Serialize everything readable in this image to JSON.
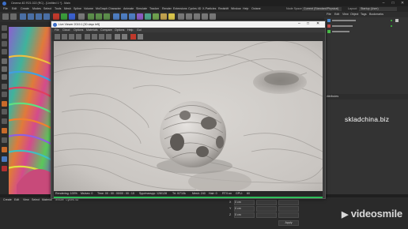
{
  "app": {
    "title": "Cinema 4D R21.022 (RC) - [Untitled 1 *] - Main",
    "win_controls": [
      "–",
      "□",
      "✕"
    ]
  },
  "main_menu": [
    "File",
    "Edit",
    "Create",
    "Modes",
    "Select",
    "Tools",
    "Mesh",
    "Spline",
    "Volume",
    "MoGraph",
    "Character",
    "Animate",
    "Simulate",
    "Tracker",
    "Render",
    "Extensions",
    "Cycles 4D",
    "X-Particles",
    "Redshift",
    "Window",
    "Help",
    "Octane"
  ],
  "node_space": {
    "label": "Node Space:",
    "value": "Current (Standard/Physical)",
    "layout_label": "Layout:",
    "layout_value": "Startup (User)"
  },
  "right_panel": {
    "tabs": [
      "File",
      "Edit",
      "View",
      "Object",
      "Tags",
      "Bookmarks"
    ],
    "attributes_label": "Attributes"
  },
  "live_viewer": {
    "title": "Live Viewer 2019.1 [30 days left]",
    "menu": [
      "File",
      "Cloud",
      "Options",
      "Materials",
      "Compare",
      "Options",
      "Help",
      "Gui"
    ],
    "status": {
      "rendering": "Rendering: 100%",
      "ms": "Ms/sec: 0",
      "time": "Time: 00 : 00 : 00/00 : 00 : 10",
      "spp": "Spp/maxspp: 128/128",
      "tri": "Tri: 0/710k",
      "mesh": "Mesh: 240",
      "hair": "Hair: 0",
      "rtx": "RTX:on",
      "gpu": "GPU:",
      "gpu_val": "60"
    },
    "progress": 1.0
  },
  "bottom_panel": {
    "menu": [
      "Create",
      "Edit",
      "View",
      "Select",
      "Material",
      "Texture",
      "Cycles 4D"
    ],
    "coord_labels": [
      "X",
      "Y",
      "Z"
    ],
    "coord_values": [
      "0 cm",
      "0 cm",
      "0 cm"
    ],
    "apply_label": "Apply"
  },
  "watermarks": {
    "site": "skladchina.biz",
    "brand": "videosmile"
  },
  "colors": {
    "accent_green": "#1c7a3a",
    "toolbar_red": "#c0392b",
    "lv_title_bg": "#f2f2f2"
  }
}
